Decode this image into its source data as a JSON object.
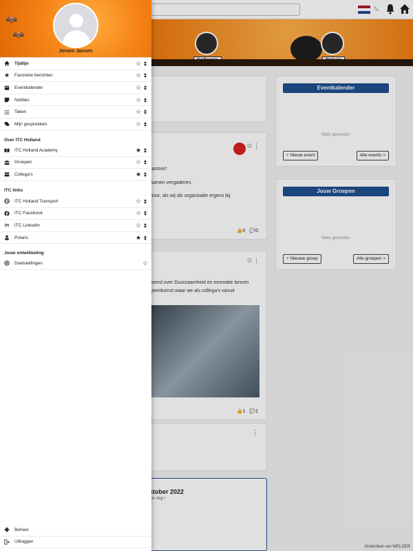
{
  "user": {
    "name": "Jeroen Jansen"
  },
  "colors": {
    "banner_orange": "#f07d12",
    "brand_blue": "#1f4f8f"
  },
  "menu_main": [
    {
      "label": "Tijdlijn",
      "icon": "home-icon",
      "starred": false,
      "bold": true
    },
    {
      "label": "Favoriete berichten",
      "icon": "star-filled-icon",
      "starred": false,
      "bold": false
    },
    {
      "label": "Eventkalender",
      "icon": "calendar-icon",
      "starred": false,
      "bold": false
    },
    {
      "label": "Notities",
      "icon": "note-icon",
      "starred": false,
      "bold": false
    },
    {
      "label": "Taken",
      "icon": "task-list-icon",
      "starred": false,
      "bold": false
    },
    {
      "label": "Mijn gesprekken",
      "icon": "chat-icon",
      "starred": false,
      "bold": false
    }
  ],
  "section_about": {
    "title": "Over ITC Holland",
    "items": [
      {
        "label": "ITC Holland Academy",
        "icon": "book-icon",
        "starred": true
      },
      {
        "label": "Groepen",
        "icon": "group-icon",
        "starred": false
      },
      {
        "label": "Collega's",
        "icon": "colleagues-icon",
        "starred": true
      }
    ]
  },
  "section_links": {
    "title": "ITC links",
    "items": [
      {
        "label": "ITC Holland Transport",
        "icon": "globe-icon",
        "starred": false
      },
      {
        "label": "ITC Facebook",
        "icon": "facebook-icon",
        "starred": false
      },
      {
        "label": "ITC LinkedIn",
        "icon": "linkedin-icon",
        "starred": false
      },
      {
        "label": "Polaris",
        "icon": "person-icon",
        "starred": true
      }
    ]
  },
  "section_dev": {
    "title": "Jouw ontwikkeling",
    "items": [
      {
        "label": "Doelstellingen",
        "icon": "target-icon",
        "starred": false
      }
    ]
  },
  "menu_bottom": [
    {
      "label": "Beheer",
      "icon": "gear-icon"
    },
    {
      "label": "Uitloggen",
      "icon": "logout-icon"
    }
  ],
  "banner": {
    "colleagues_label": "Collega's",
    "polaris_label": "Polaris"
  },
  "side_cards": {
    "events": {
      "title": "Eventkalender",
      "empty": "Niets gevonden",
      "new_btn": "+  Nieuw event",
      "all_btn": "Alle events  >"
    },
    "groups": {
      "title": "Jouw Groepen",
      "empty": "Niets gevonden",
      "new_btn": "+  Nieuwe groep",
      "all_btn": "Alle groepen  >"
    }
  },
  "feed": {
    "post1_lines": [
      "ar kantoor!",
      "en samen vergaderen.",
      "kantoor, als wij als organisatie ergens bij"
    ],
    "post1_likes": "0",
    "post1_comments": "0",
    "post2_lines": [
      "aniseerd over Duurzaamheid en innovatie binnen",
      "e bijeenkomst waar we als collega's vanuit"
    ],
    "post2_likes": "1",
    "post2_comments": "1",
    "event_title": "ktober 2022",
    "event_sub": "ele dag •"
  },
  "footer": "Onderdeel van WELDER"
}
